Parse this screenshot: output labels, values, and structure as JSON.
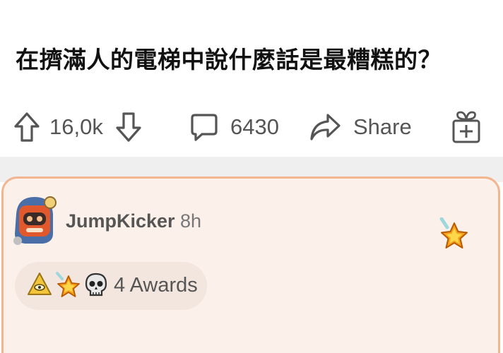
{
  "post": {
    "title": "在擠滿人的電梯中說什麼話是最糟糕的？"
  },
  "actions": {
    "upvote_count": "16,0k",
    "comment_count": "6430",
    "share_label": "Share"
  },
  "comment": {
    "username": "JumpKicker",
    "time": "8h",
    "awards_label": "4 Awards"
  },
  "colors": {
    "card_background": "#fcf1ea",
    "card_border": "#f2b58f",
    "icon_gray": "#555555"
  }
}
